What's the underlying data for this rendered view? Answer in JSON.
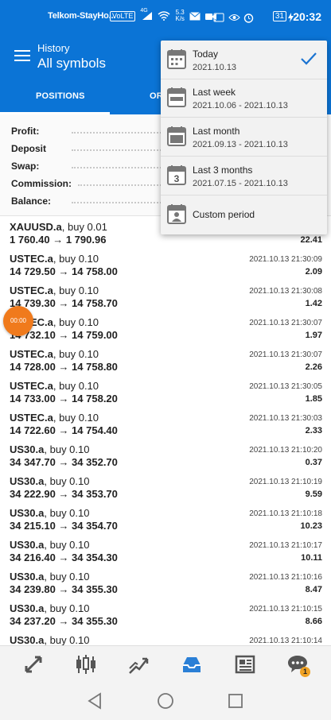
{
  "status_bar": {
    "carrier": "Telkom-StayHo...",
    "volte": "VoLTE",
    "signal": "4G",
    "net_speed_value": "5.3",
    "net_speed_unit": "K/s",
    "battery": "31",
    "time": "20:32"
  },
  "header": {
    "title": "History",
    "subtitle": "All symbols"
  },
  "tabs": [
    {
      "label": "POSITIONS"
    },
    {
      "label": "OR"
    }
  ],
  "summary": {
    "profit": "Profit:",
    "deposit": "Deposit",
    "swap": "Swap:",
    "commission": "Commission:",
    "balance": "Balance:"
  },
  "trades": [
    {
      "symbol": "XAUUSD.a",
      "side": "buy 0.01",
      "prices": "1 760.40 → 1 790.96",
      "datetime": "",
      "profit": "22.41"
    },
    {
      "symbol": "USTEC.a",
      "side": "buy 0.10",
      "prices": "14 729.50 → 14 758.00",
      "datetime": "2021.10.13 21:30:09",
      "profit": "2.09"
    },
    {
      "symbol": "USTEC.a",
      "side": "buy 0.10",
      "prices": "14 739.30 → 14 758.70",
      "datetime": "2021.10.13 21:30:08",
      "profit": "1.42"
    },
    {
      "symbol": "USTEC.a",
      "side": "buy 0.10",
      "prices": "14 732.10 → 14 759.00",
      "datetime": "2021.10.13 21:30:07",
      "profit": "1.97"
    },
    {
      "symbol": "USTEC.a",
      "side": "buy 0.10",
      "prices": "14 728.00 → 14 758.80",
      "datetime": "2021.10.13 21:30:07",
      "profit": "2.26"
    },
    {
      "symbol": "USTEC.a",
      "side": "buy 0.10",
      "prices": "14 733.00 → 14 758.20",
      "datetime": "2021.10.13 21:30:05",
      "profit": "1.85"
    },
    {
      "symbol": "USTEC.a",
      "side": "buy 0.10",
      "prices": "14 722.60 → 14 754.40",
      "datetime": "2021.10.13 21:30:03",
      "profit": "2.33"
    },
    {
      "symbol": "US30.a",
      "side": "buy 0.10",
      "prices": "34 347.70 → 34 352.70",
      "datetime": "2021.10.13 21:10:20",
      "profit": "0.37"
    },
    {
      "symbol": "US30.a",
      "side": "buy 0.10",
      "prices": "34 222.90 → 34 353.70",
      "datetime": "2021.10.13 21:10:19",
      "profit": "9.59"
    },
    {
      "symbol": "US30.a",
      "side": "buy 0.10",
      "prices": "34 215.10 → 34 354.70",
      "datetime": "2021.10.13 21:10:18",
      "profit": "10.23"
    },
    {
      "symbol": "US30.a",
      "side": "buy 0.10",
      "prices": "34 216.40 → 34 354.30",
      "datetime": "2021.10.13 21:10:17",
      "profit": "10.11"
    },
    {
      "symbol": "US30.a",
      "side": "buy 0.10",
      "prices": "34 239.80 → 34 355.30",
      "datetime": "2021.10.13 21:10:16",
      "profit": "8.47"
    },
    {
      "symbol": "US30.a",
      "side": "buy 0.10",
      "prices": "34 237.20 → 34 355.30",
      "datetime": "2021.10.13 21:10:15",
      "profit": "8.66"
    },
    {
      "symbol": "US30.a",
      "side": "buy 0.10",
      "prices": "",
      "datetime": "2021.10.13 21:10:14",
      "profit": ""
    }
  ],
  "fab": {
    "label": "00:00"
  },
  "period_menu": [
    {
      "label": "Today",
      "range": "2021.10.13",
      "icon": "calendar-today-icon",
      "selected": true
    },
    {
      "label": "Last week",
      "range": "2021.10.06 - 2021.10.13",
      "icon": "calendar-week-icon",
      "selected": false
    },
    {
      "label": "Last month",
      "range": "2021.09.13 - 2021.10.13",
      "icon": "calendar-month-icon",
      "selected": false
    },
    {
      "label": "Last 3 months",
      "range": "2021.07.15 - 2021.10.13",
      "icon": "calendar-3-icon",
      "icon_text": "3",
      "selected": false
    },
    {
      "label": "Custom period",
      "range": "",
      "icon": "calendar-person-icon",
      "selected": false
    }
  ],
  "bottom_nav": [
    {
      "icon": "quotes-icon"
    },
    {
      "icon": "chart-icon"
    },
    {
      "icon": "trade-icon"
    },
    {
      "icon": "history-icon",
      "active": true
    },
    {
      "icon": "news-icon"
    },
    {
      "icon": "messages-icon",
      "badge": "1"
    }
  ],
  "colors": {
    "primary": "#0b74d6",
    "accent_orange": "#f07a1c",
    "badge": "#f0a224",
    "check": "#1a73d1"
  }
}
